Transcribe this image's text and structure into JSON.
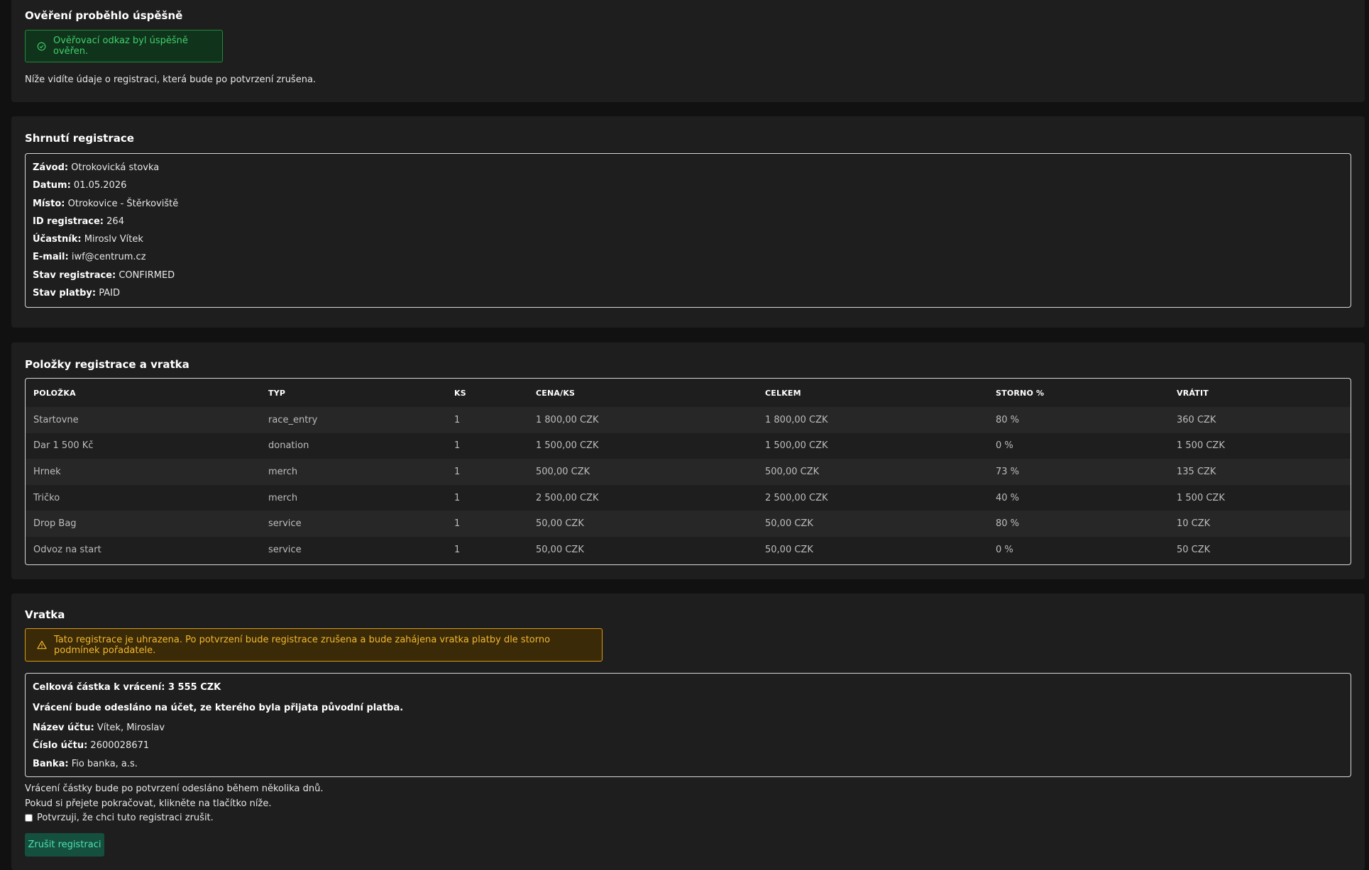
{
  "verification": {
    "title": "Ověření proběhlo úspěšně",
    "alert_icon": "check-circle-icon",
    "alert_text": "Ověřovací odkaz byl úspěšně ověřen.",
    "info": "Níže vidíte údaje o registraci, která bude po potvrzení zrušena."
  },
  "summary": {
    "title": "Shrnutí registrace",
    "fields": [
      {
        "label": "Závod:",
        "value": "Otrokovická stovka"
      },
      {
        "label": "Datum:",
        "value": "01.05.2026"
      },
      {
        "label": "Místo:",
        "value": "Otrokovice - Štěrkoviště"
      },
      {
        "label": "ID registrace:",
        "value": "264"
      },
      {
        "label": "Účastník:",
        "value": "Miroslv Vítek"
      },
      {
        "label": "E-mail:",
        "value": "iwf@centrum.cz"
      },
      {
        "label": "Stav registrace:",
        "value": "CONFIRMED"
      },
      {
        "label": "Stav platby:",
        "value": "PAID"
      }
    ]
  },
  "items": {
    "title": "Položky registrace a vratka",
    "columns": [
      "POLOŽKA",
      "TYP",
      "KS",
      "CENA/KS",
      "CELKEM",
      "STORNO %",
      "VRÁTIT"
    ],
    "rows": [
      [
        "Startovne",
        "race_entry",
        "1",
        "1 800,00 CZK",
        "1 800,00 CZK",
        "80 %",
        "360 CZK"
      ],
      [
        "Dar 1 500 Kč",
        "donation",
        "1",
        "1 500,00 CZK",
        "1 500,00 CZK",
        "0 %",
        "1 500 CZK"
      ],
      [
        "Hrnek",
        "merch",
        "1",
        "500,00 CZK",
        "500,00 CZK",
        "73 %",
        "135 CZK"
      ],
      [
        "Tričko",
        "merch",
        "1",
        "2 500,00 CZK",
        "2 500,00 CZK",
        "40 %",
        "1 500 CZK"
      ],
      [
        "Drop Bag",
        "service",
        "1",
        "50,00 CZK",
        "50,00 CZK",
        "80 %",
        "10 CZK"
      ],
      [
        "Odvoz na start",
        "service",
        "1",
        "50,00 CZK",
        "50,00 CZK",
        "0 %",
        "50 CZK"
      ]
    ]
  },
  "refund": {
    "title": "Vratka",
    "warning_icon": "warning-triangle-icon",
    "warning_text": "Tato registrace je uhrazena. Po potvrzení bude registrace zrušena a bude zahájena vratka platby dle storno podmínek pořadatele.",
    "total": "Celková částka k vrácení: 3 555 CZK",
    "account_note": "Vrácení bude odesláno na účet, ze kterého byla přijata původní platba.",
    "fields": [
      {
        "label": "Název účtu:",
        "value": "Vítek, Miroslav"
      },
      {
        "label": "Číslo účtu:",
        "value": "2600028671"
      },
      {
        "label": "Banka:",
        "value": "Fio banka, a.s."
      }
    ],
    "note1": "Vrácení částky bude po potvrzení odesláno během několika dnů.",
    "note2": "Pokud si přejete pokračovat, klikněte na tlačítko níže.",
    "confirm_label": "Potvrzuji, že chci tuto registraci zrušit.",
    "button_label": "Zrušit registraci"
  },
  "colors": {
    "background": "#111111",
    "card": "#1e1e1e",
    "success": "#3fd06a",
    "warning": "#f5b82e",
    "button": "#15503f"
  }
}
